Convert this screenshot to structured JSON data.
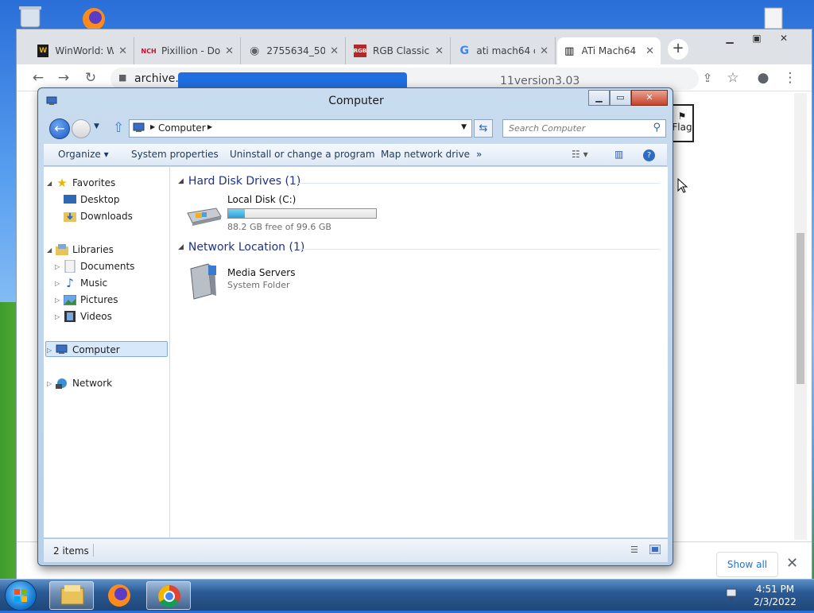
{
  "browser": {
    "tabs": [
      {
        "label": "WinWorld: W",
        "favicon": "W",
        "color": "#1a1a1a",
        "active": false
      },
      {
        "label": "Pixillion - Do",
        "favicon": "NCH",
        "color": "#c8102e",
        "active": false
      },
      {
        "label": "2755634_50",
        "favicon": "globe-icon",
        "color": "#5f6368",
        "active": false
      },
      {
        "label": "RGB Classic",
        "favicon": "RGB",
        "color": "#b02a2a",
        "active": false
      },
      {
        "label": "ati mach64 c",
        "favicon": "G",
        "color": "#4285f4",
        "active": false
      },
      {
        "label": "ATi Mach64",
        "favicon": "archive-icon",
        "color": "#000000",
        "active": true
      }
    ],
    "new_tab": "+",
    "url": "archive.o",
    "url_tail": "11version3.03",
    "page_flag_label": "Flag",
    "downloads": {
      "show_all_label": "Show all"
    }
  },
  "explorer": {
    "title": "Computer",
    "address": {
      "crumb": "Computer"
    },
    "search_placeholder": "Search Computer",
    "commands": {
      "organize": "Organize",
      "system_properties": "System properties",
      "uninstall": "Uninstall or change a program",
      "map_drive": "Map network drive",
      "more": "»"
    },
    "nav": {
      "favorites": "Favorites",
      "desktop": "Desktop",
      "downloads": "Downloads",
      "libraries": "Libraries",
      "documents": "Documents",
      "music": "Music",
      "pictures": "Pictures",
      "videos": "Videos",
      "computer": "Computer",
      "network": "Network"
    },
    "groups": {
      "hard_disk": {
        "heading": "Hard Disk Drives (1)",
        "drive_name": "Local Disk (C:)",
        "free_text": "88.2 GB free of 99.6 GB",
        "used_fraction": 0.114
      },
      "network_location": {
        "heading": "Network Location (1)",
        "item_name": "Media Servers",
        "item_type": "System Folder"
      }
    },
    "status": {
      "count": "2 items"
    }
  },
  "taskbar": {
    "time": "4:51 PM",
    "date": "2/3/2022"
  }
}
